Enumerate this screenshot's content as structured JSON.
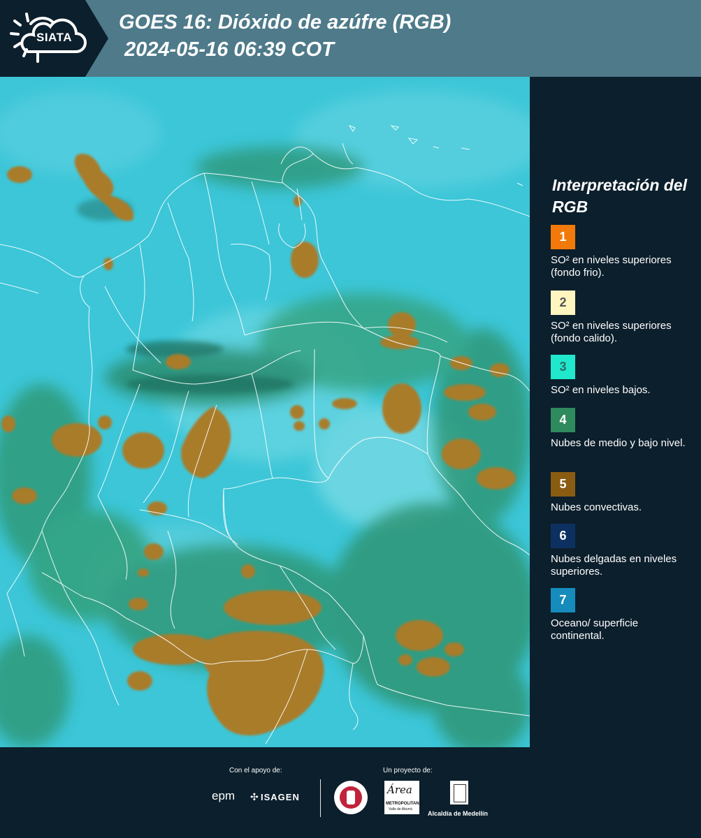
{
  "header": {
    "logo_text": "SIATA",
    "title_line1": "GOES 16: Dióxido de azúfre (RGB)",
    "title_line2": "2024-05-16 06:39 COT"
  },
  "legend": {
    "title": "Interpretación del RGB",
    "items": [
      {
        "number": "1",
        "label": "SO² en niveles superiores (fondo frio).",
        "color": "#f27a0a",
        "text_color": "#ffffff"
      },
      {
        "number": "2",
        "label": "SO² en niveles superiores (fondo calido).",
        "color": "#fef5bf",
        "text_color": "#555555"
      },
      {
        "number": "3",
        "label": "SO² en niveles bajos.",
        "color": "#20e8cc",
        "text_color": "#2a6c66"
      },
      {
        "number": "4",
        "label": "Nubes de medio y bajo nivel.",
        "color": "#2f8a5e",
        "text_color": "#ffffff"
      },
      {
        "number": "5",
        "label": "Nubes convectivas.",
        "color": "#8a5c12",
        "text_color": "#ffffff"
      },
      {
        "number": "6",
        "label": "Nubes delgadas en niveles superiores.",
        "color": "#0c3160",
        "text_color": "#ffffff"
      },
      {
        "number": "7",
        "label": "Oceano/ superficie continental.",
        "color": "#168cbc",
        "text_color": "#ffffff"
      }
    ]
  },
  "footer": {
    "support_label": "Con el apoyo de:",
    "project_label": "Un proyecto de:",
    "sponsor_epm": "epm",
    "sponsor_isagen": "ISAGEN",
    "area_metro_name": "Área",
    "area_metro_sub": "METROPOLITANA",
    "area_metro_sub2": "Valle de Aburrá",
    "alcaldia": "Alcaldía de Medellín"
  },
  "colors": {
    "background": "#0c1f2c",
    "header": "#4e7a8a",
    "map_base": "#3fc3d6",
    "convective": "#a97d2a",
    "mid_low_cloud": "#2f9a7a"
  }
}
